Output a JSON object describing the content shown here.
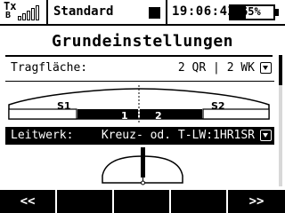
{
  "status": {
    "tx_label": "Tx",
    "tx_sub": "B",
    "signal_bars": 5,
    "model_name": "Standard",
    "time": "19:06:42",
    "battery_text": "65%",
    "battery_level": 0.35
  },
  "page": {
    "title": "Grundeinstellungen"
  },
  "rows": {
    "wing": {
      "label": "Tragfläche:",
      "value": "2 QR | 2 WK"
    },
    "tail": {
      "label": "Leitwerk:",
      "value": "Kreuz- od. T-LW:1HR1SR"
    }
  },
  "wing_diagram": {
    "segments": [
      "S1",
      "1",
      "2",
      "S2"
    ]
  },
  "softkeys": [
    "<<",
    "",
    "",
    "",
    ">>"
  ]
}
